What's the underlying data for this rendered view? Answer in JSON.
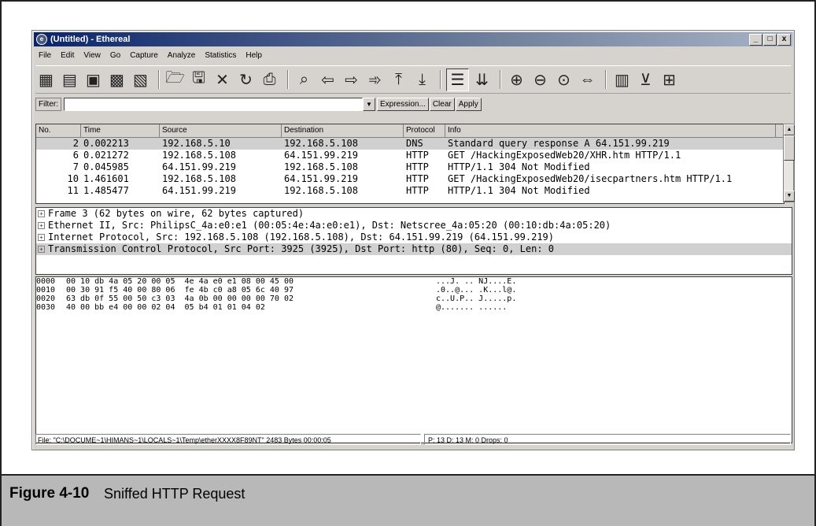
{
  "window": {
    "title": "(Untitled) - Ethereal",
    "controls": [
      "_",
      "□",
      "x"
    ]
  },
  "menu": [
    "File",
    "Edit",
    "View",
    "Go",
    "Capture",
    "Analyze",
    "Statistics",
    "Help"
  ],
  "filter": {
    "label": "Filter:",
    "value": "",
    "expression_label": "Expression...",
    "clear_label": "Clear",
    "apply_label": "Apply"
  },
  "packet_list": {
    "columns": [
      "No.",
      "Time",
      "Source",
      "Destination",
      "Protocol",
      "Info"
    ],
    "rows": [
      {
        "no": "2",
        "time": "0.002213",
        "source": "192.168.5.10",
        "destination": "192.168.5.108",
        "protocol": "DNS",
        "info": "Standard query response A 64.151.99.219"
      },
      {
        "no": "6",
        "time": "0.021272",
        "source": "192.168.5.108",
        "destination": "64.151.99.219",
        "protocol": "HTTP",
        "info": "GET /HackingExposedWeb20/XHR.htm HTTP/1.1"
      },
      {
        "no": "7",
        "time": "0.045985",
        "source": "64.151.99.219",
        "destination": "192.168.5.108",
        "protocol": "HTTP",
        "info": "HTTP/1.1 304 Not Modified"
      },
      {
        "no": "10",
        "time": "1.461601",
        "source": "192.168.5.108",
        "destination": "64.151.99.219",
        "protocol": "HTTP",
        "info": "GET /HackingExposedWeb20/isecpartners.htm HTTP/1.1"
      },
      {
        "no": "11",
        "time": "1.485477",
        "source": "64.151.99.219",
        "destination": "192.168.5.108",
        "protocol": "HTTP",
        "info": "HTTP/1.1 304 Not Modified"
      }
    ]
  },
  "details": [
    "Frame 3 (62 bytes on wire, 62 bytes captured)",
    "Ethernet II, Src: PhilipsC_4a:e0:e1 (00:05:4e:4a:e0:e1), Dst: Netscree_4a:05:20 (00:10:db:4a:05:20)",
    "Internet Protocol, Src: 192.168.5.108 (192.168.5.108), Dst: 64.151.99.219 (64.151.99.219)",
    "Transmission Control Protocol, Src Port: 3925 (3925), Dst Port: http (80), Seq: 0, Len: 0"
  ],
  "hex": [
    {
      "offset": "0000",
      "bytes": "00 10 db 4a 05 20 00 05  4e 4a e0 e1 08 00 45 00",
      "ascii": "...J. .. NJ....E."
    },
    {
      "offset": "0010",
      "bytes": "00 30 91 f5 40 00 80 06  fe 4b c0 a8 05 6c 40 97",
      "ascii": ".0..@... .K...l@."
    },
    {
      "offset": "0020",
      "bytes": "63 db 0f 55 00 50 c3 03  4a 0b 00 00 00 00 70 02",
      "ascii": "c..U.P.. J.....p."
    },
    {
      "offset": "0030",
      "bytes": "40 00 bb e4 00 00 02 04  05 b4 01 01 04 02",
      "ascii": "@....... ......"
    }
  ],
  "status": {
    "file": "File: \"C:\\DOCUME~1\\HIMANS~1\\LOCALS~1\\Temp\\etherXXXX8F89NT\" 2483 Bytes 00:00:05",
    "counts": "P: 13 D: 13 M: 0 Drops: 0"
  },
  "caption": {
    "label": "Figure 4-10",
    "text": "Sniffed HTTP Request"
  }
}
